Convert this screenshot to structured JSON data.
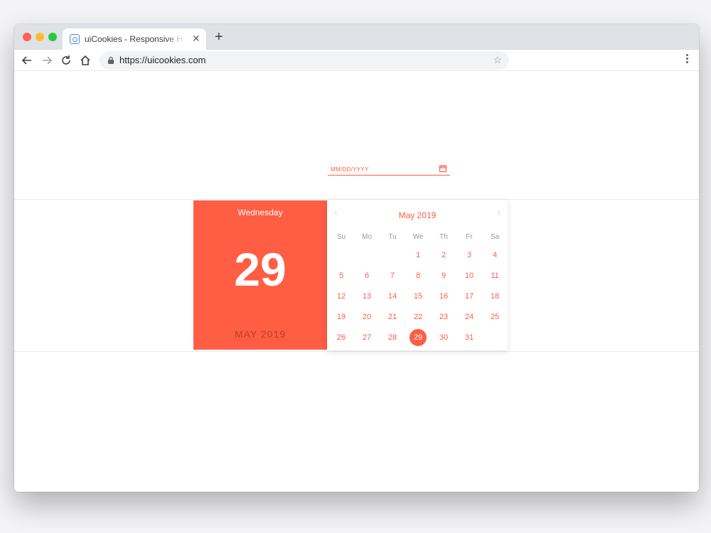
{
  "browser": {
    "tab_title": "uiCookies - Responsive HTML",
    "url": "https://uicookies.com"
  },
  "date_input": {
    "placeholder": "MM/DD/YYYY"
  },
  "date_panel": {
    "weekday": "Wednesday",
    "day": "29",
    "month_year": "MAY 2019"
  },
  "calendar": {
    "title": "May 2019",
    "weekdays": [
      "Su",
      "Mo",
      "Tu",
      "We",
      "Th",
      "Fr",
      "Sa"
    ],
    "weeks": [
      [
        "",
        "",
        "",
        "1",
        "2",
        "3",
        "4"
      ],
      [
        "5",
        "6",
        "7",
        "8",
        "9",
        "10",
        "11"
      ],
      [
        "12",
        "13",
        "14",
        "15",
        "16",
        "17",
        "18"
      ],
      [
        "19",
        "20",
        "21",
        "22",
        "23",
        "24",
        "25"
      ],
      [
        "26",
        "27",
        "28",
        "29",
        "30",
        "31",
        ""
      ]
    ],
    "selected_day": "29"
  },
  "colors": {
    "accent": "#ff5e44",
    "accent_dark": "#bf3a25"
  }
}
